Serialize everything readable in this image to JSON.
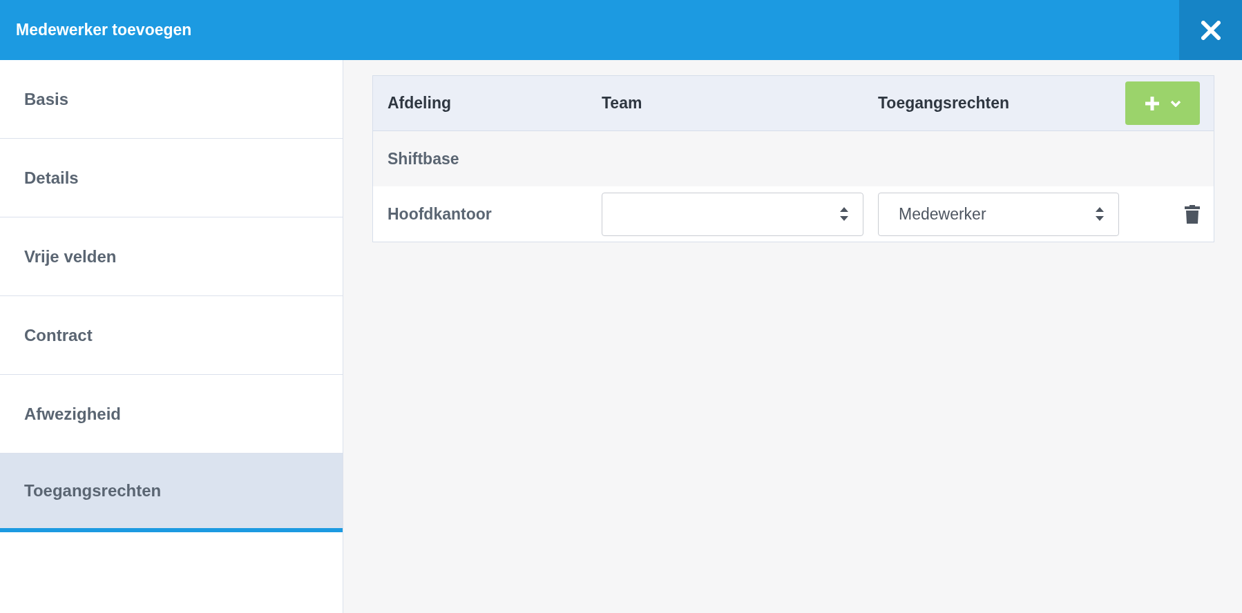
{
  "window": {
    "title": "Medewerker toevoegen"
  },
  "sidebar": {
    "items": [
      {
        "label": "Basis",
        "selected": false
      },
      {
        "label": "Details",
        "selected": false
      },
      {
        "label": "Vrije velden",
        "selected": false
      },
      {
        "label": "Contract",
        "selected": false
      },
      {
        "label": "Afwezigheid",
        "selected": false
      },
      {
        "label": "Toegangsrechten",
        "selected": true
      }
    ]
  },
  "table": {
    "columns": [
      "Afdeling",
      "Team",
      "Toegangsrechten"
    ],
    "groups": [
      {
        "name": "Shiftbase",
        "rows": [
          {
            "department": "Hoofdkantoor",
            "team": {},
            "access": {
              "value": "Medewerker"
            }
          }
        ]
      }
    ]
  }
}
